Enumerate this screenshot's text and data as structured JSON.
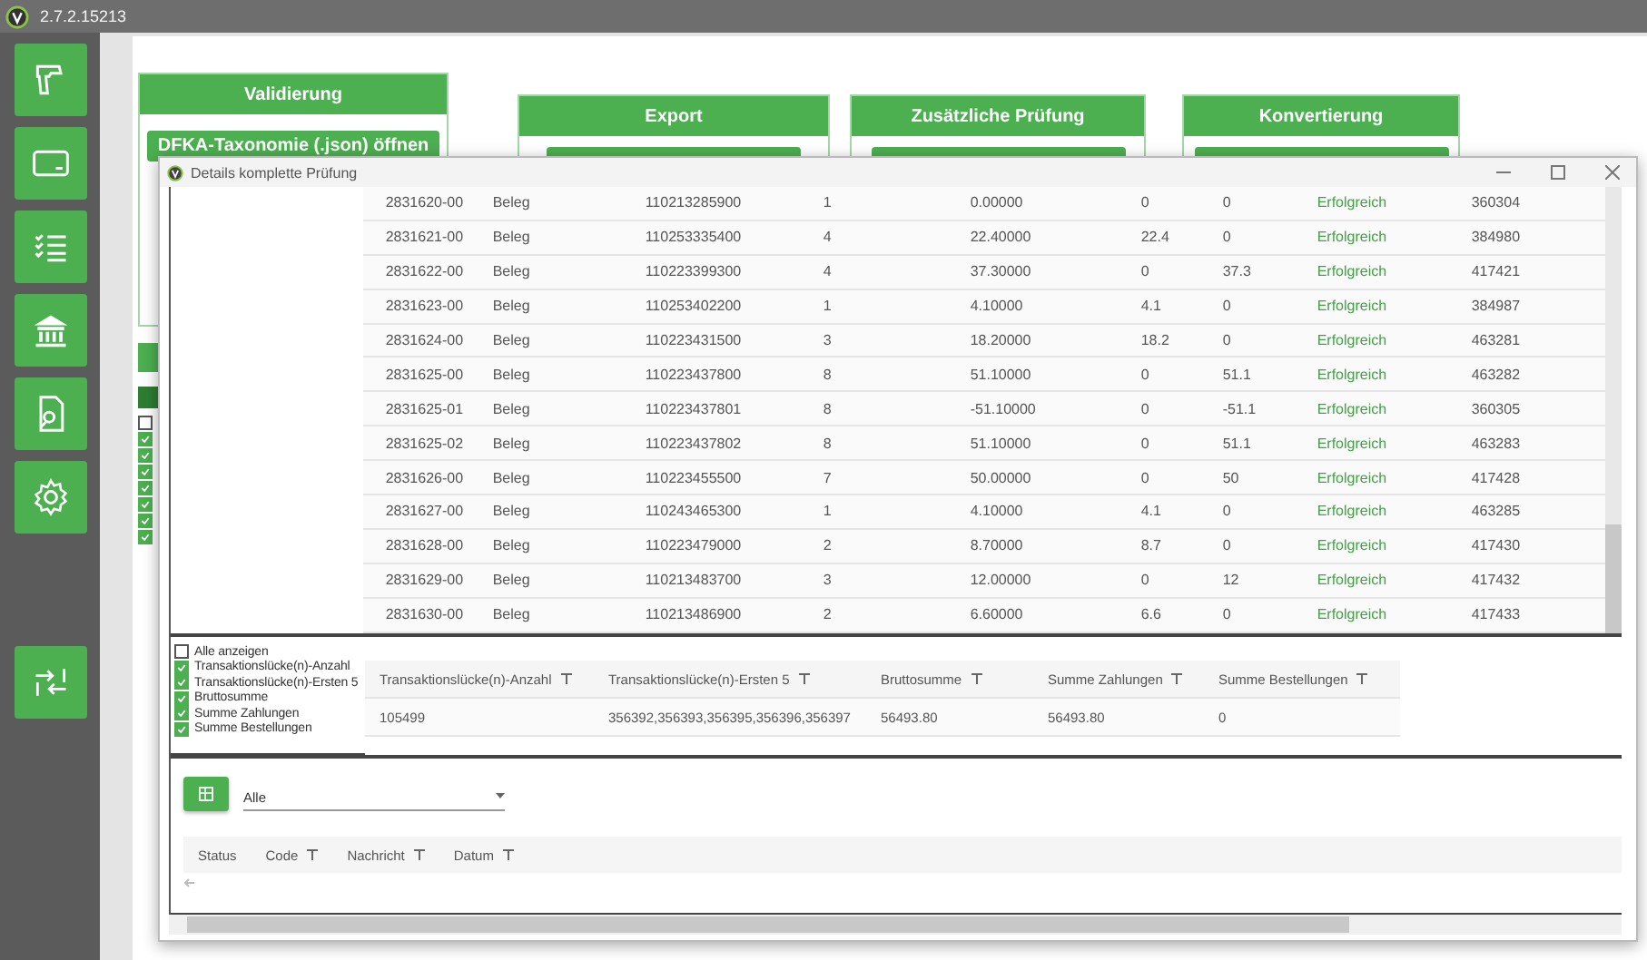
{
  "app": {
    "version": "2.7.2.15213"
  },
  "cards": [
    {
      "title": "Validierung",
      "button": "DFKA-Taxonomie (.json) öffnen"
    },
    {
      "title": "Export"
    },
    {
      "title": "Zusätzliche Prüfung"
    },
    {
      "title": "Konvertierung"
    }
  ],
  "background_checkboxes": [
    {
      "checked": false
    },
    {
      "checked": true
    },
    {
      "checked": true
    },
    {
      "checked": true
    },
    {
      "checked": true
    },
    {
      "checked": true
    },
    {
      "checked": true
    },
    {
      "checked": true
    }
  ],
  "dialog": {
    "title": "Details komplette Prüfung",
    "table": {
      "columns": [
        {
          "kind": "text"
        },
        {
          "kind": "text"
        },
        {
          "kind": "text"
        },
        {
          "kind": "text"
        },
        {
          "kind": "text"
        },
        {
          "kind": "text"
        },
        {
          "kind": "text"
        },
        {
          "kind": "status"
        },
        {
          "kind": "text"
        }
      ],
      "rows": [
        [
          "2831620-00",
          "Beleg",
          "110213285900",
          "1",
          "0.00000",
          "0",
          "0",
          "Erfolgreich",
          "360304"
        ],
        [
          "2831621-00",
          "Beleg",
          "110253335400",
          "4",
          "22.40000",
          "22.4",
          "0",
          "Erfolgreich",
          "384980"
        ],
        [
          "2831622-00",
          "Beleg",
          "110223399300",
          "4",
          "37.30000",
          "0",
          "37.3",
          "Erfolgreich",
          "417421"
        ],
        [
          "2831623-00",
          "Beleg",
          "110253402200",
          "1",
          "4.10000",
          "4.1",
          "0",
          "Erfolgreich",
          "384987"
        ],
        [
          "2831624-00",
          "Beleg",
          "110223431500",
          "3",
          "18.20000",
          "18.2",
          "0",
          "Erfolgreich",
          "463281"
        ],
        [
          "2831625-00",
          "Beleg",
          "110223437800",
          "8",
          "51.10000",
          "0",
          "51.1",
          "Erfolgreich",
          "463282"
        ],
        [
          "2831625-01",
          "Beleg",
          "110223437801",
          "8",
          "-51.10000",
          "0",
          "-51.1",
          "Erfolgreich",
          "360305"
        ],
        [
          "2831625-02",
          "Beleg",
          "110223437802",
          "8",
          "51.10000",
          "0",
          "51.1",
          "Erfolgreich",
          "463283"
        ],
        [
          "2831626-00",
          "Beleg",
          "110223455500",
          "7",
          "50.00000",
          "0",
          "50",
          "Erfolgreich",
          "417428"
        ],
        [
          "2831627-00",
          "Beleg",
          "110243465300",
          "1",
          "4.10000",
          "4.1",
          "0",
          "Erfolgreich",
          "463285"
        ],
        [
          "2831628-00",
          "Beleg",
          "110223479000",
          "2",
          "8.70000",
          "8.7",
          "0",
          "Erfolgreich",
          "417430"
        ],
        [
          "2831629-00",
          "Beleg",
          "110213483700",
          "3",
          "12.00000",
          "0",
          "12",
          "Erfolgreich",
          "417432"
        ],
        [
          "2831630-00",
          "Beleg",
          "110213486900",
          "2",
          "6.60000",
          "6.6",
          "0",
          "Erfolgreich",
          "417433"
        ]
      ]
    },
    "column_options": [
      {
        "label": "Alle anzeigen",
        "checked": false
      },
      {
        "label": "Transaktionslücke(n)-Anzahl",
        "checked": true
      },
      {
        "label": "Transaktionslücke(n)-Ersten 5",
        "checked": true
      },
      {
        "label": "Bruttosumme",
        "checked": true
      },
      {
        "label": "Summe Zahlungen",
        "checked": true
      },
      {
        "label": "Summe Bestellungen",
        "checked": true
      }
    ],
    "summary": {
      "columns": [
        {
          "label": "Transaktionslücke(n)-Anzahl",
          "filter": true
        },
        {
          "label": "Transaktionslücke(n)-Ersten 5",
          "filter": true
        },
        {
          "label": "Bruttosumme",
          "filter": true
        },
        {
          "label": "Summe Zahlungen",
          "filter": true
        },
        {
          "label": "Summe Bestellungen",
          "filter": true
        }
      ],
      "rows": [
        [
          "105499",
          "356392,356393,356395,356396,356397",
          "56493.80",
          "56493.80",
          "0"
        ]
      ]
    },
    "filter": {
      "value": "Alle"
    },
    "log": {
      "columns": [
        {
          "label": "Status",
          "filter": false
        },
        {
          "label": "Code",
          "filter": true
        },
        {
          "label": "Nachricht",
          "filter": true
        },
        {
          "label": "Datum",
          "filter": true
        }
      ]
    }
  }
}
